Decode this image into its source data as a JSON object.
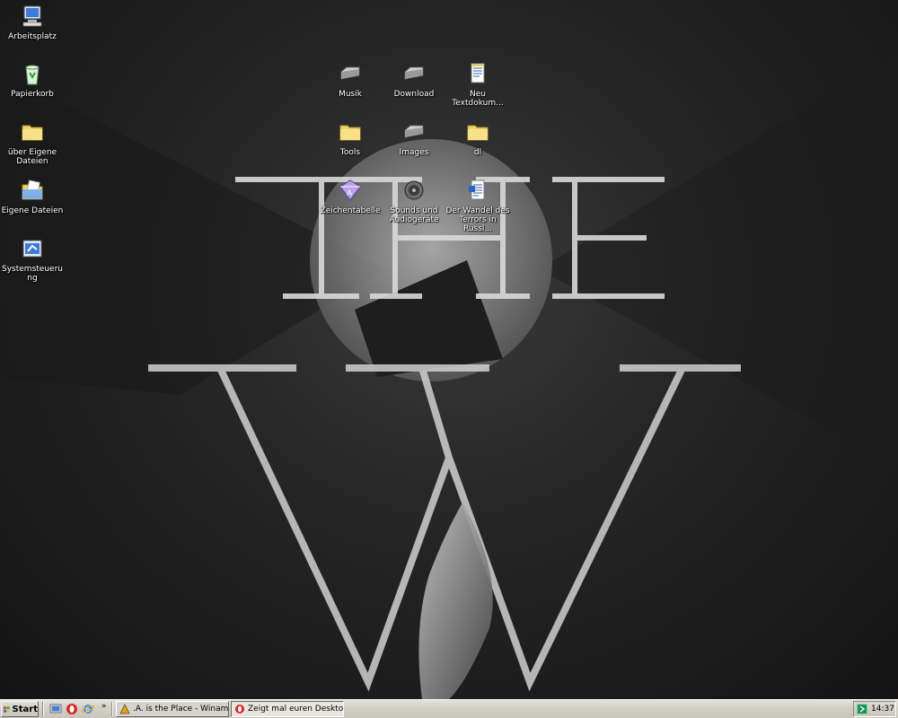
{
  "desktop": {
    "left_icons": [
      {
        "label": "Arbeitsplatz",
        "icon": "computer-icon"
      },
      {
        "label": "Papierkorb",
        "icon": "recycle-bin-icon"
      },
      {
        "label": "über Eigene Dateien",
        "icon": "folder-icon"
      },
      {
        "label": "Eigene Dateien",
        "icon": "my-documents-icon"
      },
      {
        "label": "Systemsteuerung",
        "icon": "control-panel-icon"
      }
    ],
    "center_icons": [
      {
        "label": "Musik",
        "icon": "drive-icon"
      },
      {
        "label": "Download",
        "icon": "drive-icon"
      },
      {
        "label": "Neu Textdokum...",
        "icon": "text-document-icon"
      },
      {
        "label": "Tools",
        "icon": "folder-icon"
      },
      {
        "label": "Images",
        "icon": "drive-icon"
      },
      {
        "label": "dl",
        "icon": "folder-icon"
      },
      {
        "label": "Zeichentabelle",
        "icon": "character-map-icon"
      },
      {
        "label": "Sounds und Audiogeräte",
        "icon": "speaker-icon"
      },
      {
        "label": "Der Wandel des Terrors in Russl...",
        "icon": "document-icon"
      }
    ]
  },
  "taskbar": {
    "start_label": "Start",
    "quick_launch": [
      "show-desktop-icon",
      "opera-icon",
      "internet-explorer-icon"
    ],
    "more_label": "»",
    "tasks": [
      {
        "label": ".A. is the Place - Winamp...",
        "icon": "winamp-icon",
        "active": false
      },
      {
        "label": "Zeigt mal euren Desktop!...",
        "icon": "opera-icon",
        "active": true
      }
    ],
    "tray_icon": "tray-app-icon",
    "clock": "14:37"
  }
}
